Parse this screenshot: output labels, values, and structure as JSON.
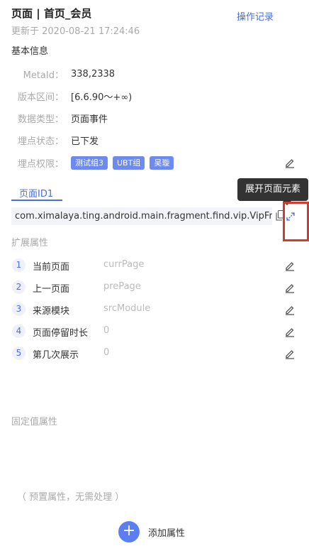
{
  "header": {
    "title": "页面 | 首页_会员",
    "op_log": "操作记录",
    "updated": "更新于 2020-08-21 17:24:46"
  },
  "basic": {
    "section_title": "基本信息",
    "rows": [
      {
        "label": "MetaId：",
        "value": "338,2338"
      },
      {
        "label": "版本区间：",
        "value": "[6.6.90～+∞)"
      },
      {
        "label": "数据类型：",
        "value": "页面事件"
      },
      {
        "label": "埋点状态：",
        "value": "已下发"
      }
    ],
    "permission_label": "埋点权限：",
    "permission_tags": [
      "测试组3",
      "UBT组",
      "吴璇"
    ]
  },
  "page_id": {
    "tab_label": "页面ID1",
    "value": "com.ximalaya.ting.android.main.fragment.find.vip.VipFragment",
    "tooltip": "展开页面元素"
  },
  "ext": {
    "section_title": "扩展属性",
    "items": [
      {
        "num": "1",
        "name": "当前页面",
        "key": "currPage"
      },
      {
        "num": "2",
        "name": "上一页面",
        "key": "prePage"
      },
      {
        "num": "3",
        "name": "来源模块",
        "key": "srcModule"
      },
      {
        "num": "4",
        "name": "页面停留时长",
        "key": "0"
      },
      {
        "num": "5",
        "name": "第几次展示",
        "key": "0"
      }
    ]
  },
  "fixed": {
    "section_title": "固定值属性",
    "preset_note": "（ 预置属性，无需处理 ）"
  },
  "actions": {
    "add_attr": "添加属性",
    "add_icon": "+"
  },
  "colors": {
    "accent": "#4a6ee0",
    "tag_bg": "#6c8aef",
    "highlight": "#d23b2e"
  }
}
